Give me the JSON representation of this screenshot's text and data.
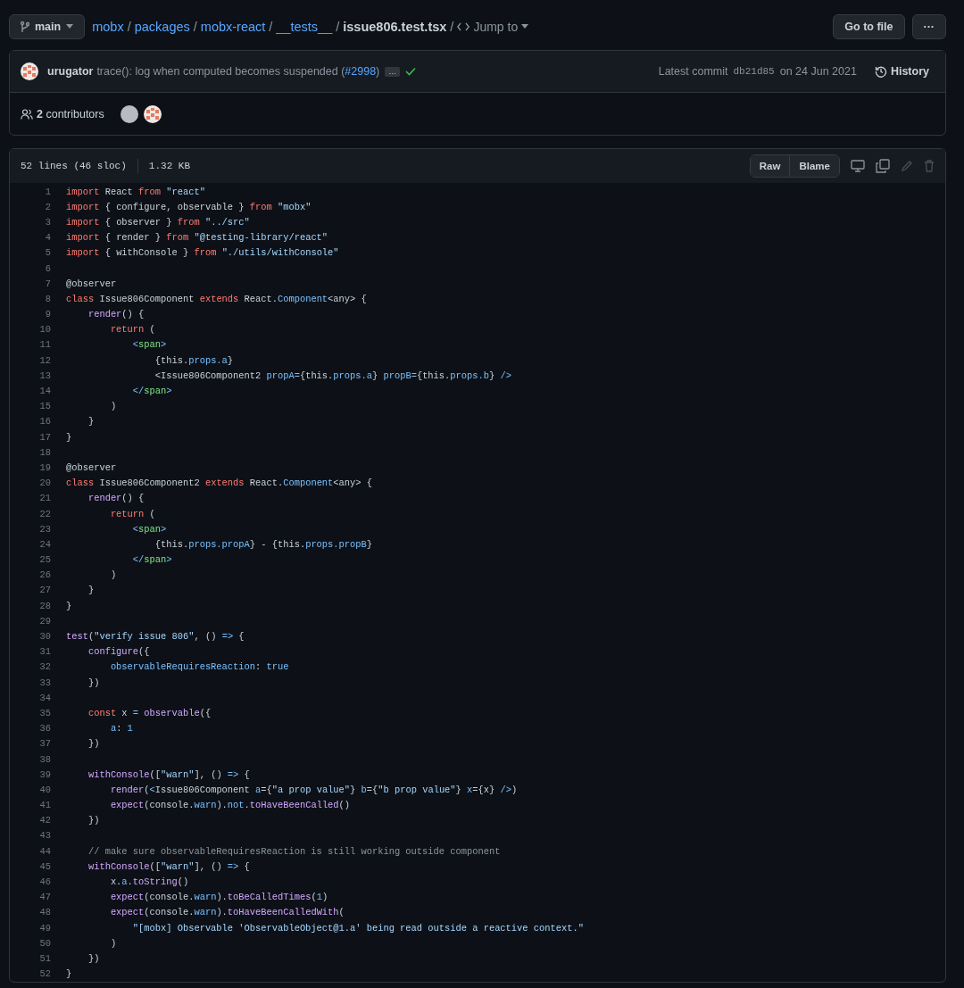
{
  "branch": {
    "name": "main"
  },
  "breadcrumb": {
    "folders": [
      {
        "text": "mobx",
        "separator": "/"
      },
      {
        "text": "packages",
        "separator": "/"
      },
      {
        "text": "mobx-react",
        "separator": "/"
      },
      {
        "text": "__tests__",
        "separator": "/"
      }
    ],
    "file": "issue806.test.tsx",
    "file_separator": "/",
    "jump_to": "Jump to"
  },
  "header_buttons": {
    "go_to_file": "Go to file",
    "more": "···"
  },
  "commit": {
    "author": "urugator",
    "message": "trace(): log when computed becomes suspended (",
    "pr_link": "#2998",
    "message_end": ")",
    "expand": "…",
    "status_ok": true,
    "latest_label": "Latest commit",
    "sha": "db21d85",
    "date": "on 24 Jun 2021",
    "history": "History"
  },
  "contributors": {
    "label": "**2** contributors"
  },
  "file_info": {
    "lines": "52 lines (46 sloc)",
    "size": "1.32 KB",
    "raw": "Raw",
    "blame": "Blame"
  },
  "code": [
    {
      "number": "1",
      "tokens": [
        {
          "kind": "keyword",
          "text": "import"
        },
        {
          "kind": "plain",
          "text": " React "
        },
        {
          "kind": "keyword",
          "text": "from "
        },
        {
          "kind": "string",
          "text": "\"react\""
        }
      ]
    },
    {
      "number": "2",
      "tokens": [
        {
          "kind": "keyword",
          "text": "import"
        },
        {
          "kind": "plain",
          "text": " { configure, observable } "
        },
        {
          "kind": "keyword",
          "text": "from "
        },
        {
          "kind": "string",
          "text": "\"mobx\""
        }
      ]
    },
    {
      "number": "3",
      "tokens": [
        {
          "kind": "keyword",
          "text": "import"
        },
        {
          "kind": "plain",
          "text": " { observer } "
        },
        {
          "kind": "keyword",
          "text": "from "
        },
        {
          "kind": "string",
          "text": "\"../src\""
        }
      ]
    },
    {
      "number": "4",
      "tokens": [
        {
          "kind": "keyword",
          "text": "import"
        },
        {
          "kind": "plain",
          "text": " { render } "
        },
        {
          "kind": "keyword",
          "text": "from "
        },
        {
          "kind": "string",
          "text": "\"@testing-library/react\""
        }
      ]
    },
    {
      "number": "5",
      "tokens": [
        {
          "kind": "keyword",
          "text": "import"
        },
        {
          "kind": "plain",
          "text": " { withConsole } "
        },
        {
          "kind": "keyword",
          "text": "from "
        },
        {
          "kind": "string",
          "text": "\"./utils/withConsole\""
        }
      ]
    },
    {
      "number": "6"
    },
    {
      "number": "7",
      "tokens": [
        {
          "kind": "plain",
          "text": "@observer"
        }
      ]
    },
    {
      "number": "8",
      "tokens": [
        {
          "kind": "keyword",
          "text": "class"
        },
        {
          "kind": "plain",
          "text": " Issue806Component "
        },
        {
          "kind": "keyword",
          "text": "extends"
        },
        {
          "kind": "plain",
          "text": " React."
        },
        {
          "kind": "constant",
          "text": "Component"
        },
        {
          "kind": "plain",
          "text": "<any> {"
        }
      ]
    },
    {
      "number": "9",
      "tokens": [
        {
          "kind": "function",
          "text": "    render"
        },
        {
          "kind": "plain",
          "text": "() {"
        }
      ]
    },
    {
      "number": "10",
      "tokens": [
        {
          "kind": "keyword",
          "text": "        return"
        },
        {
          "kind": "plain",
          "text": " ("
        }
      ]
    },
    {
      "number": "11",
      "tokens": [
        {
          "kind": "constant",
          "text": "            <"
        },
        {
          "kind": "tag",
          "text": "span"
        },
        {
          "kind": "constant",
          "text": ">"
        }
      ]
    },
    {
      "number": "12",
      "tokens": [
        {
          "kind": "plain",
          "text": "                {this."
        },
        {
          "kind": "constant",
          "text": "props.a"
        },
        {
          "kind": "plain",
          "text": "}"
        }
      ]
    },
    {
      "number": "13",
      "tokens": [
        {
          "kind": "plain",
          "text": "                <Issue806Component2 "
        },
        {
          "kind": "constant",
          "text": "propA="
        },
        {
          "kind": "plain",
          "text": "{this."
        },
        {
          "kind": "constant",
          "text": "props.a"
        },
        {
          "kind": "plain",
          "text": "} "
        },
        {
          "kind": "constant",
          "text": "propB="
        },
        {
          "kind": "plain",
          "text": "{this."
        },
        {
          "kind": "constant",
          "text": "props.b"
        },
        {
          "kind": "plain",
          "text": "} "
        },
        {
          "kind": "constant",
          "text": "/>"
        }
      ]
    },
    {
      "number": "14",
      "tokens": [
        {
          "kind": "constant",
          "text": "            </"
        },
        {
          "kind": "tag",
          "text": "span"
        },
        {
          "kind": "constant",
          "text": ">"
        }
      ]
    },
    {
      "number": "15",
      "tokens": [
        {
          "kind": "plain",
          "text": "        )"
        }
      ]
    },
    {
      "number": "16",
      "tokens": [
        {
          "kind": "plain",
          "text": "    }"
        }
      ]
    },
    {
      "number": "17",
      "tokens": [
        {
          "kind": "plain",
          "text": "}"
        }
      ]
    },
    {
      "number": "18"
    },
    {
      "number": "19",
      "tokens": [
        {
          "kind": "plain",
          "text": "@observer"
        }
      ]
    },
    {
      "number": "20",
      "tokens": [
        {
          "kind": "keyword",
          "text": "class"
        },
        {
          "kind": "plain",
          "text": " Issue806Component2 "
        },
        {
          "kind": "keyword",
          "text": "extends"
        },
        {
          "kind": "plain",
          "text": " React."
        },
        {
          "kind": "constant",
          "text": "Component"
        },
        {
          "kind": "plain",
          "text": "<any> {"
        }
      ]
    },
    {
      "number": "21",
      "tokens": [
        {
          "kind": "function",
          "text": "    render"
        },
        {
          "kind": "plain",
          "text": "() {"
        }
      ]
    },
    {
      "number": "22",
      "tokens": [
        {
          "kind": "keyword",
          "text": "        return"
        },
        {
          "kind": "plain",
          "text": " ("
        }
      ]
    },
    {
      "number": "23",
      "tokens": [
        {
          "kind": "constant",
          "text": "            <"
        },
        {
          "kind": "tag",
          "text": "span"
        },
        {
          "kind": "constant",
          "text": ">"
        }
      ]
    },
    {
      "number": "24",
      "tokens": [
        {
          "kind": "plain",
          "text": "                {this."
        },
        {
          "kind": "constant",
          "text": "props.propA"
        },
        {
          "kind": "plain",
          "text": "} - {this."
        },
        {
          "kind": "constant",
          "text": "props.propB"
        },
        {
          "kind": "plain",
          "text": "}"
        }
      ]
    },
    {
      "number": "25",
      "tokens": [
        {
          "kind": "constant",
          "text": "            </"
        },
        {
          "kind": "tag",
          "text": "span"
        },
        {
          "kind": "constant",
          "text": ">"
        }
      ]
    },
    {
      "number": "26",
      "tokens": [
        {
          "kind": "plain",
          "text": "        )"
        }
      ]
    },
    {
      "number": "27",
      "tokens": [
        {
          "kind": "plain",
          "text": "    }"
        }
      ]
    },
    {
      "number": "28",
      "tokens": [
        {
          "kind": "plain",
          "text": "}"
        }
      ]
    },
    {
      "number": "29"
    },
    {
      "number": "30",
      "tokens": [
        {
          "kind": "function",
          "text": "test"
        },
        {
          "kind": "plain",
          "text": "("
        },
        {
          "kind": "string",
          "text": "\"verify issue 806\""
        },
        {
          "kind": "plain",
          "text": ", () "
        },
        {
          "kind": "constant",
          "text": "=>"
        },
        {
          "kind": "plain",
          "text": " {"
        }
      ]
    },
    {
      "number": "31",
      "tokens": [
        {
          "kind": "function",
          "text": "    configure"
        },
        {
          "kind": "plain",
          "text": "({"
        }
      ]
    },
    {
      "number": "32",
      "tokens": [
        {
          "kind": "constant",
          "text": "        observableRequiresReaction"
        },
        {
          "kind": "plain",
          "text": ": "
        },
        {
          "kind": "constant",
          "text": "true"
        }
      ]
    },
    {
      "number": "33",
      "tokens": [
        {
          "kind": "plain",
          "text": "    })"
        }
      ]
    },
    {
      "number": "34"
    },
    {
      "number": "35",
      "tokens": [
        {
          "kind": "keyword",
          "text": "    const"
        },
        {
          "kind": "plain",
          "text": " x "
        },
        {
          "kind": "constant",
          "text": "= "
        },
        {
          "kind": "function",
          "text": "observable"
        },
        {
          "kind": "plain",
          "text": "({"
        }
      ]
    },
    {
      "number": "36",
      "tokens": [
        {
          "kind": "constant",
          "text": "        a"
        },
        {
          "kind": "plain",
          "text": ": "
        },
        {
          "kind": "constant",
          "text": "1"
        }
      ]
    },
    {
      "number": "37",
      "tokens": [
        {
          "kind": "plain",
          "text": "    })"
        }
      ]
    },
    {
      "number": "38"
    },
    {
      "number": "39",
      "tokens": [
        {
          "kind": "function",
          "text": "    withConsole"
        },
        {
          "kind": "plain",
          "text": "(["
        },
        {
          "kind": "string",
          "text": "\"warn\""
        },
        {
          "kind": "plain",
          "text": "], () "
        },
        {
          "kind": "constant",
          "text": "=>"
        },
        {
          "kind": "plain",
          "text": " {"
        }
      ]
    },
    {
      "number": "40",
      "tokens": [
        {
          "kind": "function",
          "text": "        render"
        },
        {
          "kind": "plain",
          "text": "("
        },
        {
          "kind": "constant",
          "text": "<"
        },
        {
          "kind": "plain",
          "text": "Issue806Component "
        },
        {
          "kind": "constant",
          "text": "a"
        },
        {
          "kind": "plain",
          "text": "={"
        },
        {
          "kind": "string",
          "text": "\"a prop value\""
        },
        {
          "kind": "plain",
          "text": "} "
        },
        {
          "kind": "constant",
          "text": "b"
        },
        {
          "kind": "plain",
          "text": "={"
        },
        {
          "kind": "string",
          "text": "\"b prop value\""
        },
        {
          "kind": "plain",
          "text": "} "
        },
        {
          "kind": "constant",
          "text": "x"
        },
        {
          "kind": "plain",
          "text": "={x} "
        },
        {
          "kind": "constant",
          "text": "/>"
        },
        {
          "kind": "plain",
          "text": ")"
        }
      ]
    },
    {
      "number": "41",
      "tokens": [
        {
          "kind": "function",
          "text": "        expect"
        },
        {
          "kind": "plain",
          "text": "(console."
        },
        {
          "kind": "constant",
          "text": "warn"
        },
        {
          "kind": "plain",
          "text": ")."
        },
        {
          "kind": "constant",
          "text": "not"
        },
        {
          "kind": "plain",
          "text": "."
        },
        {
          "kind": "function",
          "text": "toHaveBeenCalled"
        },
        {
          "kind": "plain",
          "text": "()"
        }
      ]
    },
    {
      "number": "42",
      "tokens": [
        {
          "kind": "plain",
          "text": "    })"
        }
      ]
    },
    {
      "number": "43"
    },
    {
      "number": "44",
      "tokens": [
        {
          "kind": "comment",
          "text": "    // make sure observableRequiresReaction is still working outside component"
        }
      ]
    },
    {
      "number": "45",
      "tokens": [
        {
          "kind": "function",
          "text": "    withConsole"
        },
        {
          "kind": "plain",
          "text": "(["
        },
        {
          "kind": "string",
          "text": "\"warn\""
        },
        {
          "kind": "plain",
          "text": "], () "
        },
        {
          "kind": "constant",
          "text": "=>"
        },
        {
          "kind": "plain",
          "text": " {"
        }
      ]
    },
    {
      "number": "46",
      "tokens": [
        {
          "kind": "plain",
          "text": "        x."
        },
        {
          "kind": "constant",
          "text": "a"
        },
        {
          "kind": "plain",
          "text": "."
        },
        {
          "kind": "function",
          "text": "toString"
        },
        {
          "kind": "plain",
          "text": "()"
        }
      ]
    },
    {
      "number": "47",
      "tokens": [
        {
          "kind": "function",
          "text": "        expect"
        },
        {
          "kind": "plain",
          "text": "(console."
        },
        {
          "kind": "constant",
          "text": "warn"
        },
        {
          "kind": "plain",
          "text": ")."
        },
        {
          "kind": "function",
          "text": "toBeCalledTimes"
        },
        {
          "kind": "plain",
          "text": "("
        },
        {
          "kind": "constant",
          "text": "1"
        },
        {
          "kind": "plain",
          "text": ")"
        }
      ]
    },
    {
      "number": "48",
      "tokens": [
        {
          "kind": "function",
          "text": "        expect"
        },
        {
          "kind": "plain",
          "text": "(console."
        },
        {
          "kind": "constant",
          "text": "warn"
        },
        {
          "kind": "plain",
          "text": ")."
        },
        {
          "kind": "function",
          "text": "toHaveBeenCalledWith"
        },
        {
          "kind": "plain",
          "text": "("
        }
      ]
    },
    {
      "number": "49",
      "tokens": [
        {
          "kind": "string",
          "text": "            \"[mobx] Observable 'ObservableObject@1.a' being read outside a reactive context.\""
        }
      ]
    },
    {
      "number": "50",
      "tokens": [
        {
          "kind": "plain",
          "text": "        )"
        }
      ]
    },
    {
      "number": "51",
      "tokens": [
        {
          "kind": "plain",
          "text": "    })"
        }
      ]
    },
    {
      "number": "52",
      "tokens": [
        {
          "kind": "plain",
          "text": "}"
        }
      ]
    }
  ]
}
